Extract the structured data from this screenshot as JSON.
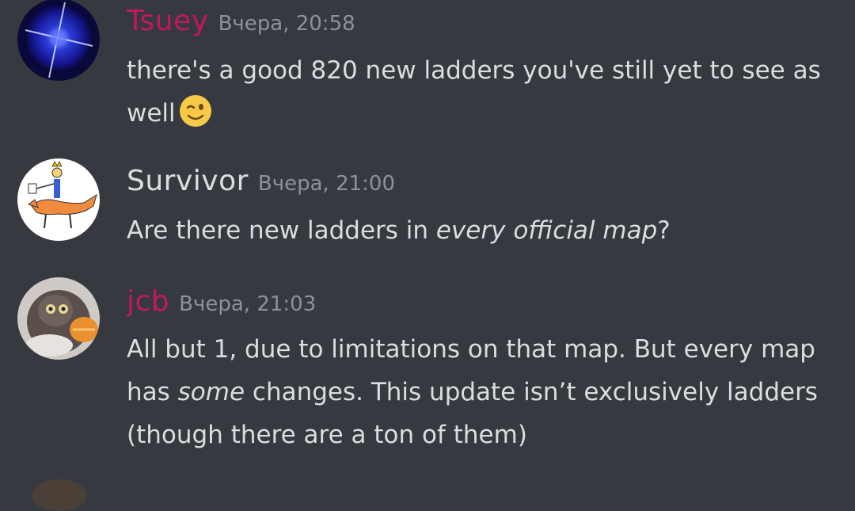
{
  "messages": [
    {
      "author": "Tsuey",
      "author_color": "#c2185b",
      "timestamp": "Вчера, 20:58",
      "lines": [
        "there's a good 820 new ladders you've still yet to see as",
        "well"
      ],
      "emoji": "winking-face"
    },
    {
      "author": "Survivor",
      "author_color": "#dcddde",
      "timestamp": "Вчера, 21:00",
      "text_prefix": "Are there new ladders in ",
      "text_em": "every official map",
      "text_suffix": "?"
    },
    {
      "author": "jcb",
      "author_color": "#c2185b",
      "timestamp": "Вчера, 21:03",
      "line1": "All but 1, due to limitations on that map. But every map",
      "line2_prefix": "has ",
      "line2_em": "some",
      "line2_suffix": " changes. This update isn’t exclusively ladders",
      "line3": "(though there are a ton of them)"
    }
  ]
}
